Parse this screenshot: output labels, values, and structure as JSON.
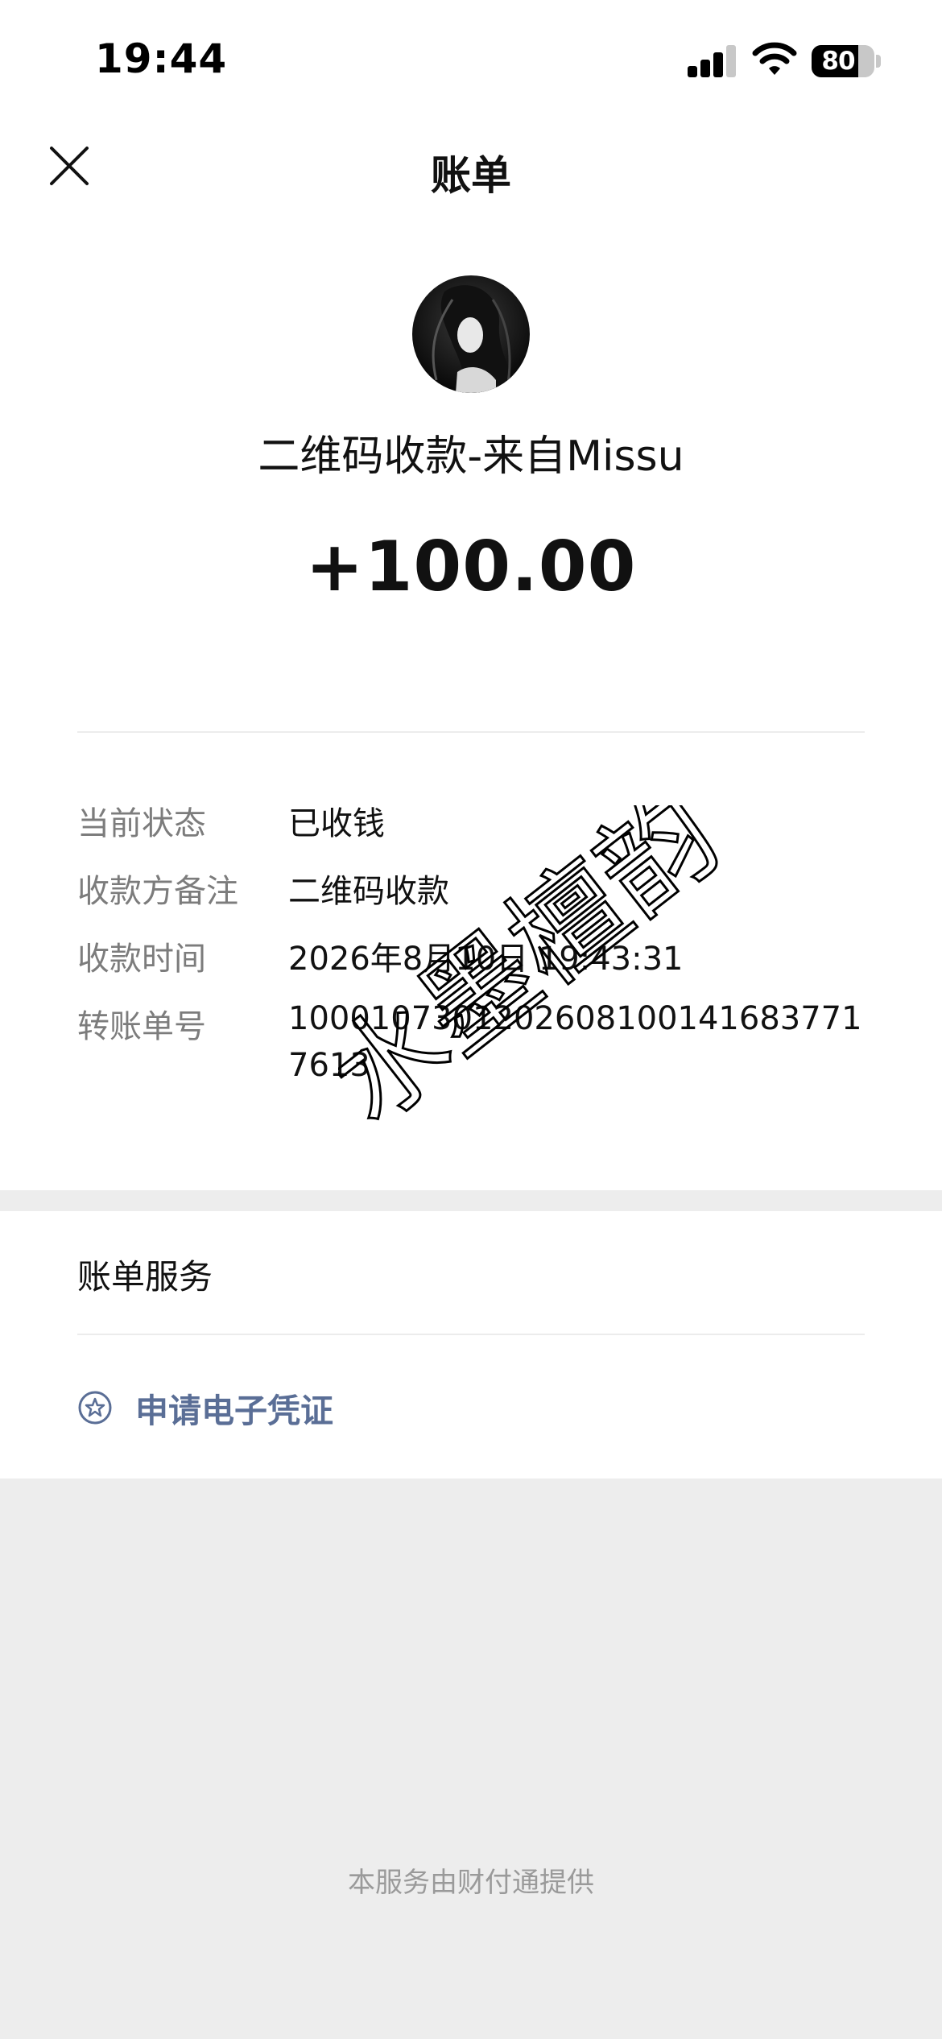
{
  "status_bar": {
    "time": "19:44",
    "battery": "80"
  },
  "nav": {
    "title": "账单"
  },
  "header": {
    "payer": "二维码收款-来自Missu",
    "amount": "+100.00"
  },
  "details": [
    {
      "label": "当前状态",
      "value": "已收钱"
    },
    {
      "label": "收款方备注",
      "value": "二维码收款"
    },
    {
      "label": "收款时间",
      "value": "2026年8月10日 19:43:31"
    },
    {
      "label": "转账单号",
      "value": "10001073012026081001416837717613"
    }
  ],
  "watermark": "水墨檀韵",
  "service": {
    "title": "账单服务",
    "voucher_label": "申请电子凭证"
  },
  "footer": "本服务由财付通提供",
  "colors": {
    "link": "#5a6e96",
    "muted": "#7c7c7c",
    "page_bg": "#ededed"
  },
  "icons": [
    "signal-icon",
    "wifi-icon",
    "battery-icon",
    "close-icon",
    "avatar",
    "star-circle-icon"
  ]
}
